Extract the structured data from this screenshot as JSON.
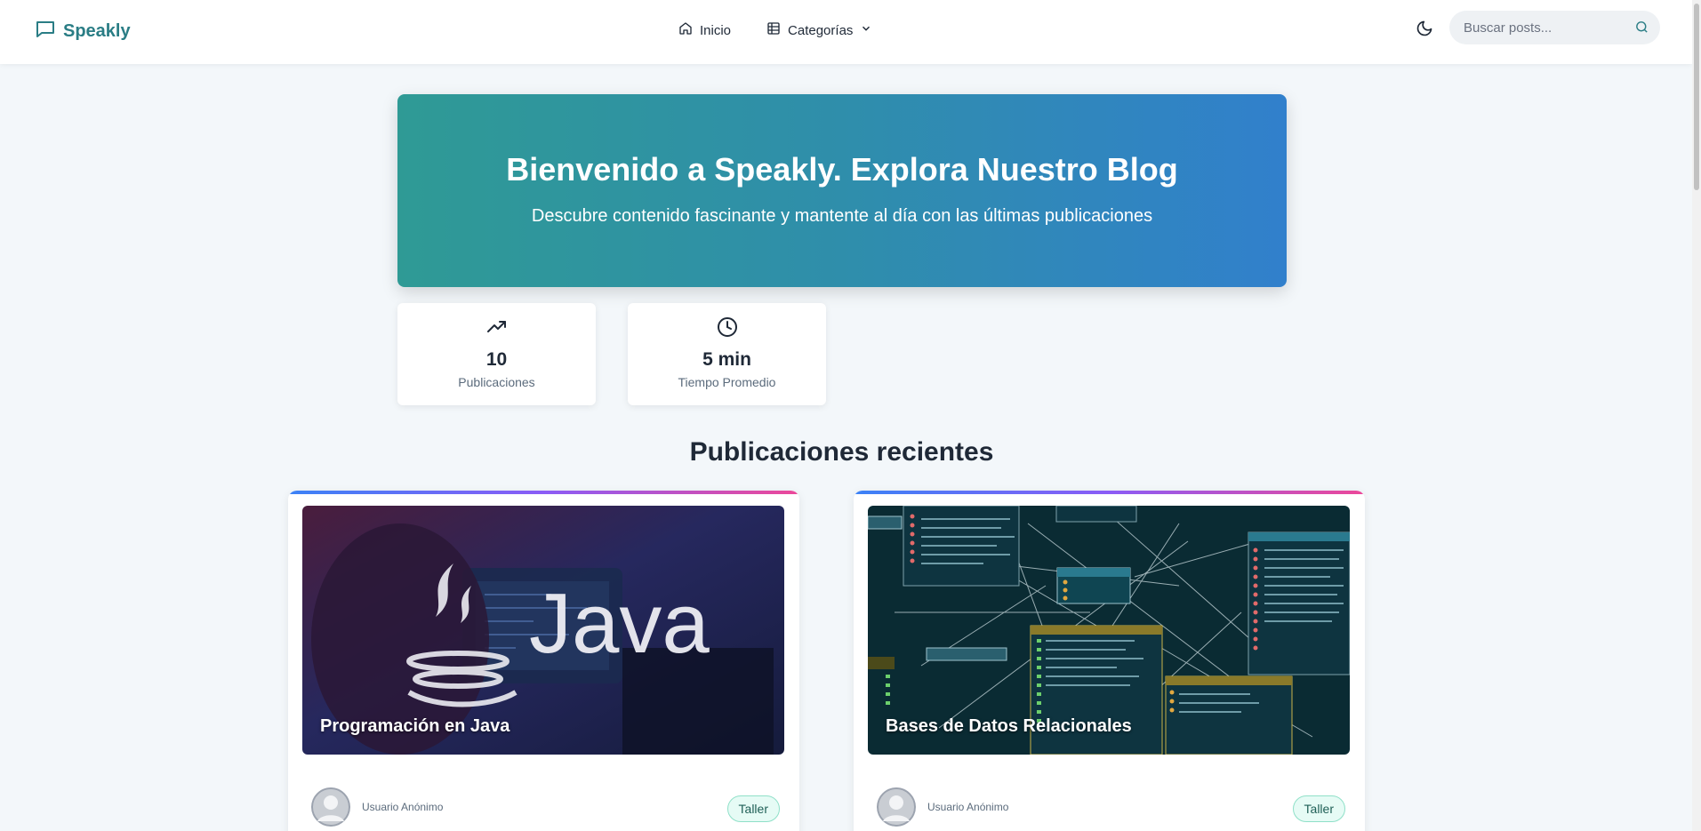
{
  "navbar": {
    "brand": "Speakly",
    "home_label": "Inicio",
    "categories_label": "Categorías",
    "search_placeholder": "Buscar posts..."
  },
  "hero": {
    "title": "Bienvenido a Speakly. Explora Nuestro Blog",
    "subtitle": "Descubre contenido fascinante y mantente al día con las últimas publicaciones"
  },
  "stats": [
    {
      "value": "10",
      "label": "Publicaciones",
      "icon": "trending-up-icon"
    },
    {
      "value": "5 min",
      "label": "Tiempo Promedio",
      "icon": "clock-icon"
    }
  ],
  "section_title": "Publicaciones recientes",
  "posts": [
    {
      "image_title": "Programación en Java",
      "image_logo_text": "Java",
      "author": "Usuario Anónimo",
      "tag": "Taller"
    },
    {
      "image_title": "Bases de Datos Relacionales",
      "author": "Usuario Anónimo",
      "tag": "Taller"
    }
  ],
  "colors": {
    "brand": "#2a7d85",
    "hero_gradient_start": "#2f9a95",
    "hero_gradient_end": "#3180cc",
    "tag_bg": "#e6fbf5"
  }
}
